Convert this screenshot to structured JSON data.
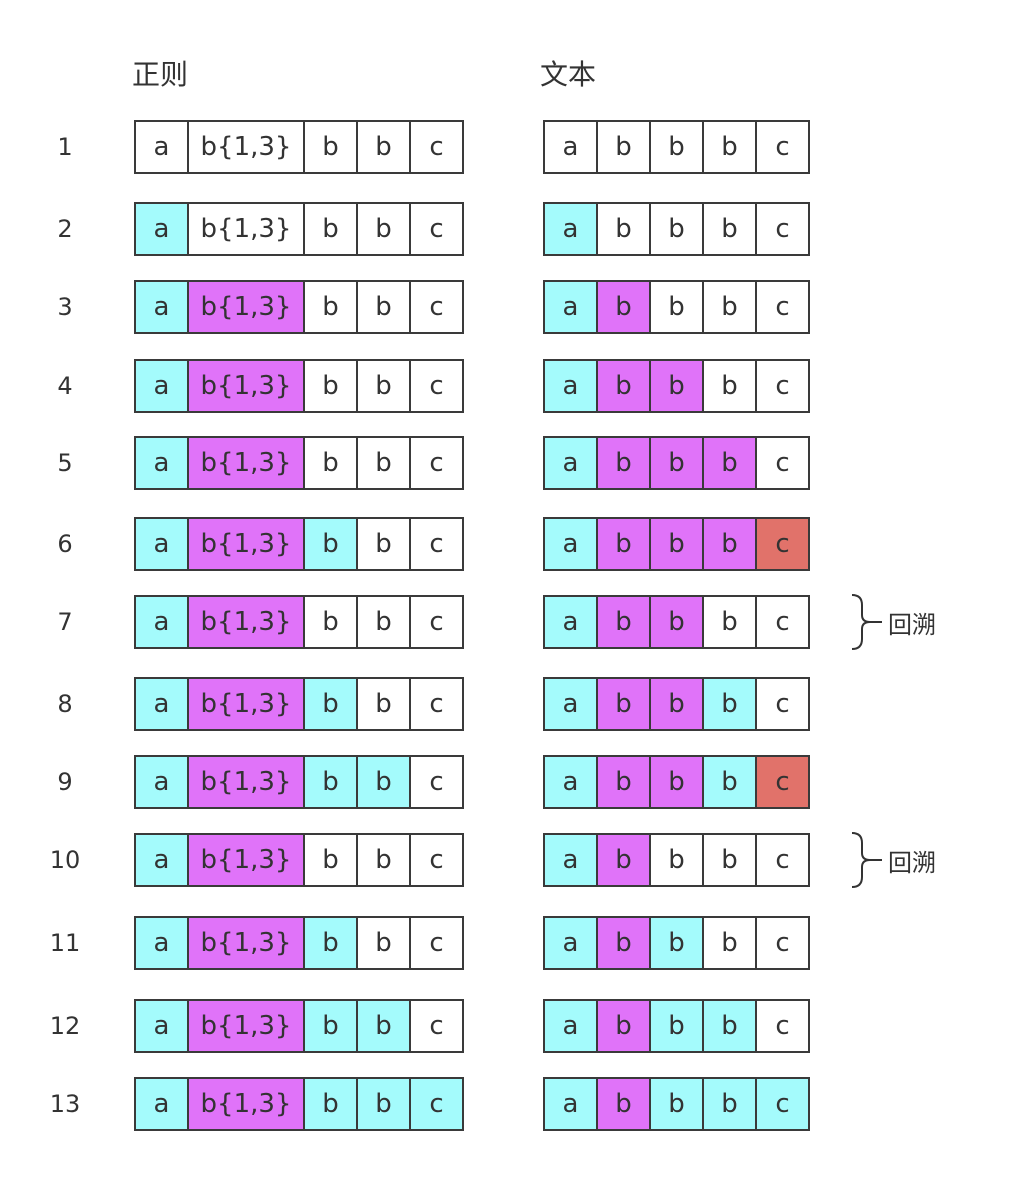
{
  "headers": {
    "regex": "正则",
    "text": "文本"
  },
  "colors": {
    "white": "#ffffff",
    "cyan": "#a4fbfc",
    "purple": "#e073f9",
    "red": "#e1726a"
  },
  "regex_tokens": [
    "a",
    "b{1,3}",
    "b",
    "b",
    "c"
  ],
  "text_chars": [
    "a",
    "b",
    "b",
    "b",
    "c"
  ],
  "rows": [
    {
      "num": "1",
      "regex": [
        "white",
        "white",
        "white",
        "white",
        "white"
      ],
      "text": [
        "white",
        "white",
        "white",
        "white",
        "white"
      ],
      "annotation": ""
    },
    {
      "num": "2",
      "regex": [
        "cyan",
        "white",
        "white",
        "white",
        "white"
      ],
      "text": [
        "cyan",
        "white",
        "white",
        "white",
        "white"
      ],
      "annotation": ""
    },
    {
      "num": "3",
      "regex": [
        "cyan",
        "purple",
        "white",
        "white",
        "white"
      ],
      "text": [
        "cyan",
        "purple",
        "white",
        "white",
        "white"
      ],
      "annotation": ""
    },
    {
      "num": "4",
      "regex": [
        "cyan",
        "purple",
        "white",
        "white",
        "white"
      ],
      "text": [
        "cyan",
        "purple",
        "purple",
        "white",
        "white"
      ],
      "annotation": ""
    },
    {
      "num": "5",
      "regex": [
        "cyan",
        "purple",
        "white",
        "white",
        "white"
      ],
      "text": [
        "cyan",
        "purple",
        "purple",
        "purple",
        "white"
      ],
      "annotation": ""
    },
    {
      "num": "6",
      "regex": [
        "cyan",
        "purple",
        "cyan",
        "white",
        "white"
      ],
      "text": [
        "cyan",
        "purple",
        "purple",
        "purple",
        "red"
      ],
      "annotation": ""
    },
    {
      "num": "7",
      "regex": [
        "cyan",
        "purple",
        "white",
        "white",
        "white"
      ],
      "text": [
        "cyan",
        "purple",
        "purple",
        "white",
        "white"
      ],
      "annotation": "回溯"
    },
    {
      "num": "8",
      "regex": [
        "cyan",
        "purple",
        "cyan",
        "white",
        "white"
      ],
      "text": [
        "cyan",
        "purple",
        "purple",
        "cyan",
        "white"
      ],
      "annotation": ""
    },
    {
      "num": "9",
      "regex": [
        "cyan",
        "purple",
        "cyan",
        "cyan",
        "white"
      ],
      "text": [
        "cyan",
        "purple",
        "purple",
        "cyan",
        "red"
      ],
      "annotation": ""
    },
    {
      "num": "10",
      "regex": [
        "cyan",
        "purple",
        "white",
        "white",
        "white"
      ],
      "text": [
        "cyan",
        "purple",
        "white",
        "white",
        "white"
      ],
      "annotation": "回溯"
    },
    {
      "num": "11",
      "regex": [
        "cyan",
        "purple",
        "cyan",
        "white",
        "white"
      ],
      "text": [
        "cyan",
        "purple",
        "cyan",
        "white",
        "white"
      ],
      "annotation": ""
    },
    {
      "num": "12",
      "regex": [
        "cyan",
        "purple",
        "cyan",
        "cyan",
        "white"
      ],
      "text": [
        "cyan",
        "purple",
        "cyan",
        "cyan",
        "white"
      ],
      "annotation": ""
    },
    {
      "num": "13",
      "regex": [
        "cyan",
        "purple",
        "cyan",
        "cyan",
        "cyan"
      ],
      "text": [
        "cyan",
        "purple",
        "cyan",
        "cyan",
        "cyan"
      ],
      "annotation": ""
    }
  ]
}
